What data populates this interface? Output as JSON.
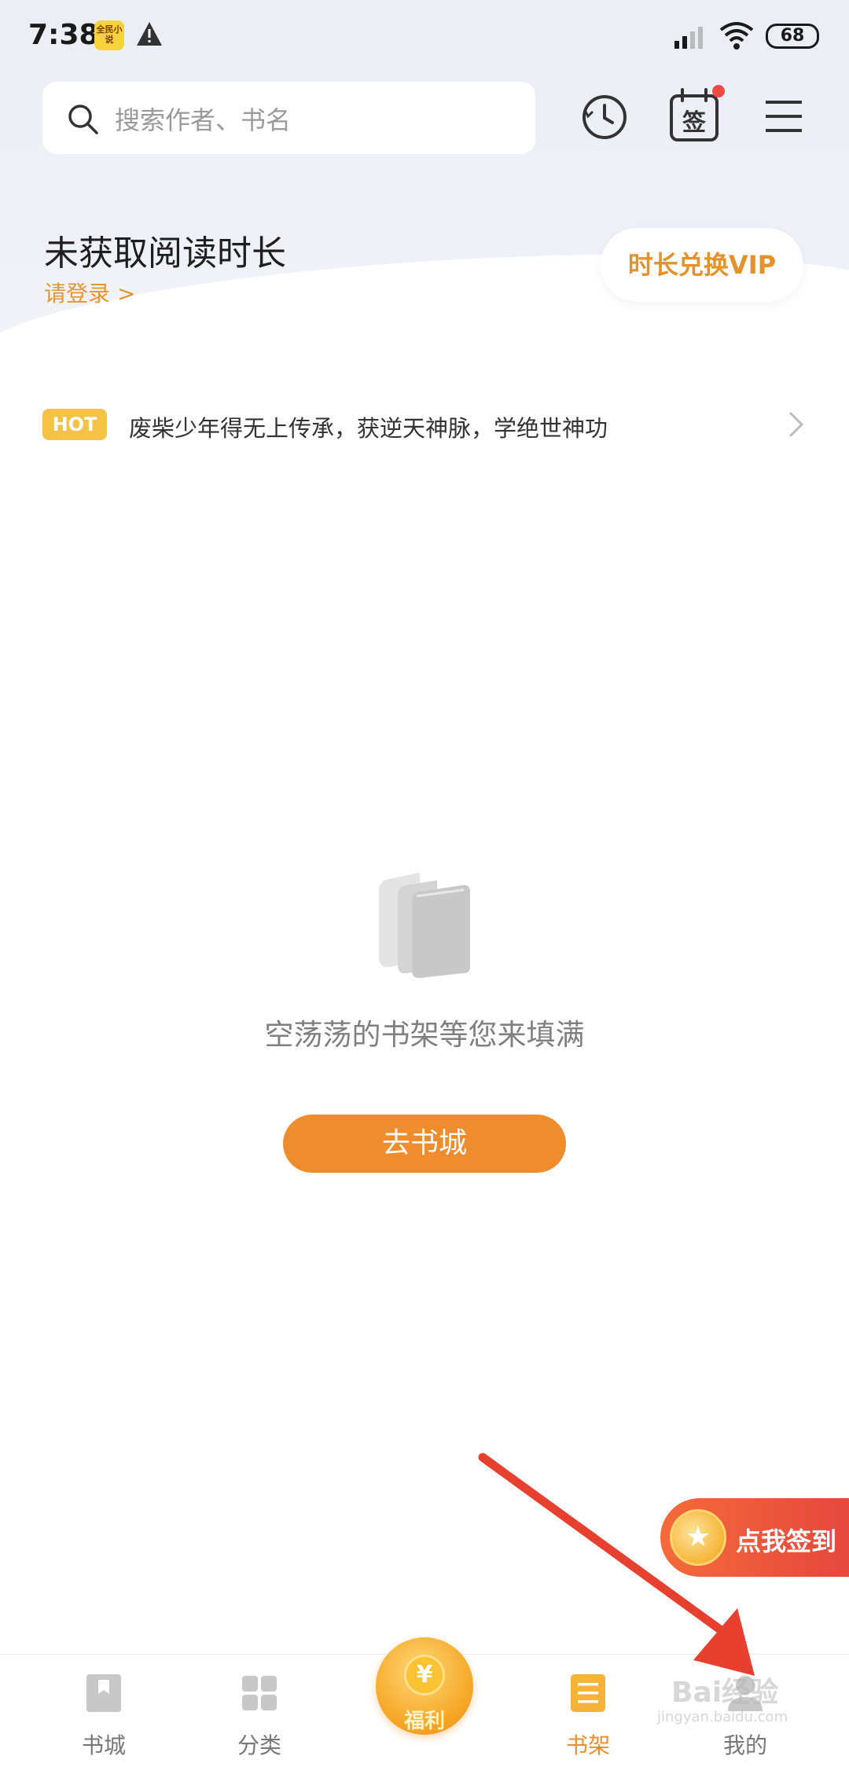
{
  "status_bar": {
    "time": "7:38",
    "app_badge_text": "全民小说",
    "battery": "68"
  },
  "header": {
    "search_placeholder": "搜索作者、书名",
    "icons": [
      "history-icon",
      "check-in-icon",
      "menu-icon"
    ]
  },
  "reading": {
    "title": "未获取阅读时长",
    "login_link": "请登录 >",
    "vip_button": "时长兑换VIP"
  },
  "hot": {
    "badge": "HOT",
    "text": "废柴少年得无上传承，获逆天神脉，学绝世神功"
  },
  "empty_state": {
    "message": "空荡荡的书架等您来填满",
    "button": "去书城"
  },
  "floating_sign": {
    "coin_icon": "★",
    "label": "点我签到"
  },
  "tab_bar": {
    "tabs": [
      {
        "label": "书城",
        "icon": "bookstore-icon"
      },
      {
        "label": "分类",
        "icon": "category-icon"
      },
      {
        "label": "福利",
        "icon": "welfare-coin-icon",
        "coin": "¥"
      },
      {
        "label": "书架",
        "icon": "bookshelf-icon",
        "active": true
      },
      {
        "label": "我的",
        "icon": "profile-icon"
      }
    ]
  },
  "watermark": {
    "line1": "Bai经验",
    "line2": "jingyan.baidu.com"
  },
  "colors": {
    "accent": "#ef8c2e",
    "hot_badge": "#f4c245",
    "vip_text": "#e3922c",
    "sign_float": "#e6473e"
  }
}
